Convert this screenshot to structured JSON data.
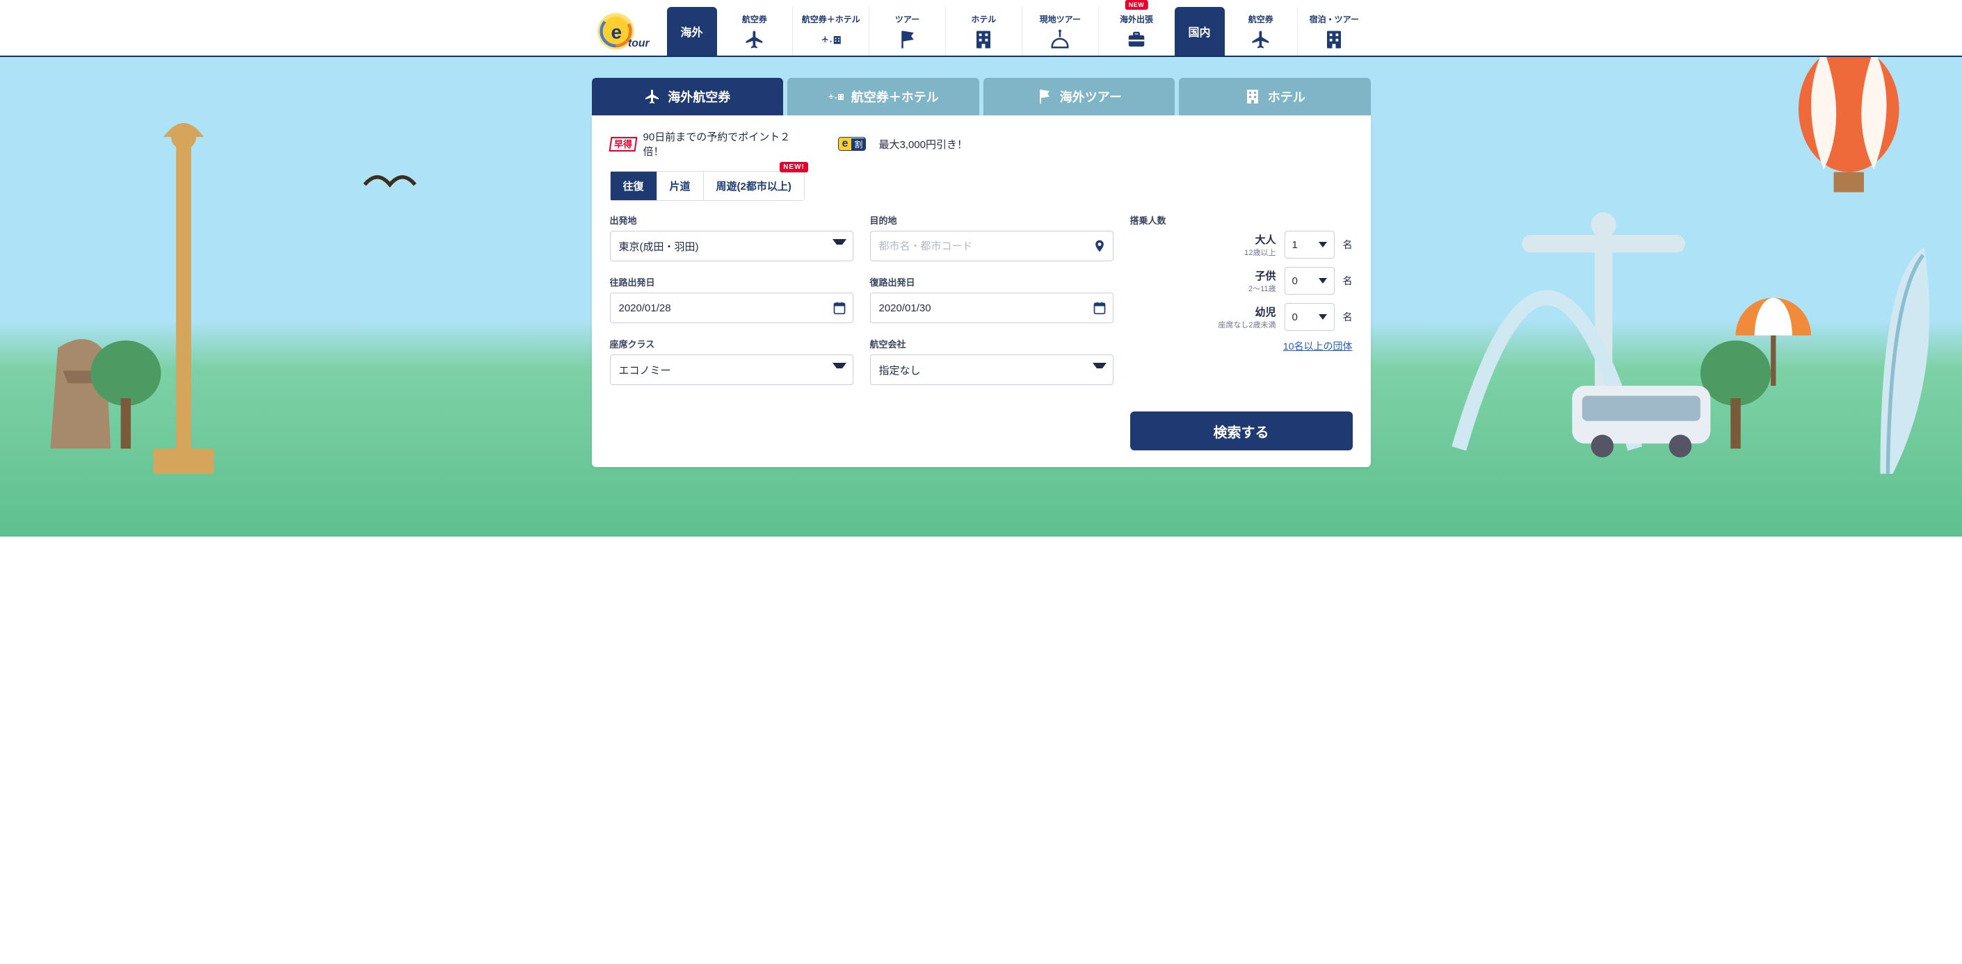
{
  "brand": {
    "name": "etour",
    "tagline": "tour"
  },
  "header": {
    "overseas_btn": "海外",
    "domestic_btn": "国内",
    "overseas_nav": [
      {
        "id": "flight",
        "label": "航空券",
        "icon": "plane"
      },
      {
        "id": "flight-hotel",
        "label": "航空券＋ホテル",
        "icon": "plane-hotel"
      },
      {
        "id": "tour",
        "label": "ツアー",
        "icon": "flag"
      },
      {
        "id": "hotel",
        "label": "ホテル",
        "icon": "building"
      },
      {
        "id": "local-tour",
        "label": "現地ツアー",
        "icon": "arc"
      },
      {
        "id": "biz-trip",
        "label": "海外出張",
        "icon": "briefcase",
        "badge": "NEW"
      }
    ],
    "domestic_nav": [
      {
        "id": "dom-flight",
        "label": "航空券",
        "icon": "plane"
      },
      {
        "id": "dom-stay",
        "label": "宿泊・ツアー",
        "icon": "building"
      }
    ]
  },
  "colors": {
    "navy": "#1f3a73",
    "teal": "#7fb5c7",
    "red": "#e6002d",
    "yellow": "#ffcf2d"
  },
  "search": {
    "tabs": [
      {
        "id": "flight",
        "label": "海外航空券",
        "icon": "plane",
        "active": true
      },
      {
        "id": "flight-hotel",
        "label": "航空券＋ホテル",
        "icon": "plane-hotel",
        "active": false
      },
      {
        "id": "tour",
        "label": "海外ツアー",
        "icon": "flag",
        "active": false
      },
      {
        "id": "hotel",
        "label": "ホテル",
        "icon": "building",
        "active": false
      }
    ],
    "promos": {
      "hayatoku_badge": "早得",
      "hayatoku_text": "90日前までの予約でポイント２倍！",
      "ewari_badge_e": "e",
      "ewari_badge_wari": "割",
      "ewari_text": "最大3,000円引き！"
    },
    "trip_type": [
      {
        "id": "round",
        "label": "往復",
        "active": true
      },
      {
        "id": "oneway",
        "label": "片道"
      },
      {
        "id": "multi",
        "label": "周遊(2都市以上)",
        "badge": "NEW!"
      }
    ],
    "fields": {
      "origin": {
        "label": "出発地",
        "value": "東京(成田・羽田)"
      },
      "dest": {
        "label": "目的地",
        "placeholder": "都市名・都市コード",
        "value": ""
      },
      "depart_date": {
        "label": "往路出発日",
        "value": "2020/01/28"
      },
      "return_date": {
        "label": "復路出発日",
        "value": "2020/01/30"
      },
      "cabin": {
        "label": "座席クラス",
        "value": "エコノミー"
      },
      "airline": {
        "label": "航空会社",
        "value": "指定なし"
      }
    },
    "pax": {
      "heading": "搭乗人数",
      "adult": {
        "label": "大人",
        "sub": "12歳以上",
        "value": "1",
        "unit": "名"
      },
      "child": {
        "label": "子供",
        "sub": "2〜11歳",
        "value": "0",
        "unit": "名"
      },
      "infant": {
        "label": "幼児",
        "sub": "座席なし2歳未満",
        "value": "0",
        "unit": "名"
      },
      "group_link": "10名以上の団体"
    },
    "search_button": "検索する"
  }
}
